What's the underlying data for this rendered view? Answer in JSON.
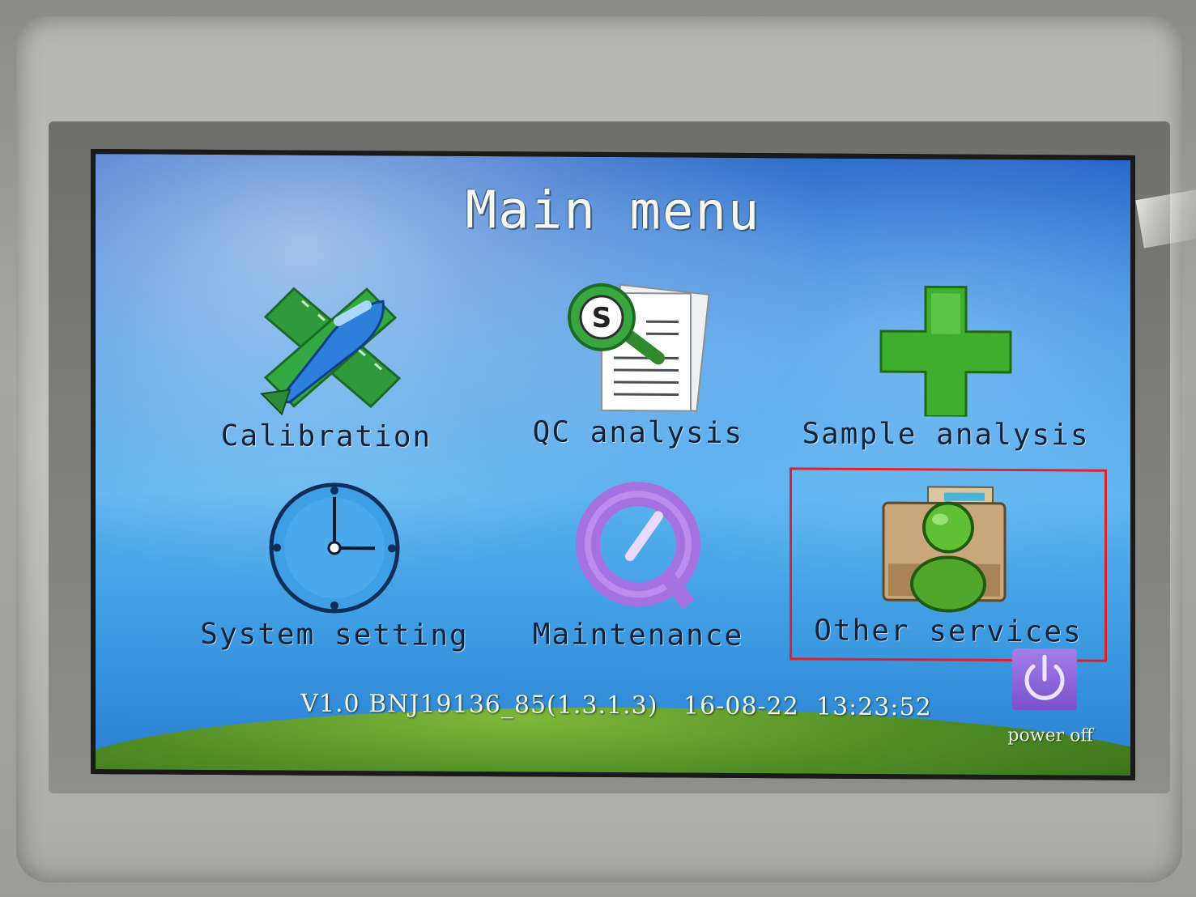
{
  "title": "Main menu",
  "menu": [
    {
      "label": "Calibration",
      "icon": "calibration-icon"
    },
    {
      "label": "QC analysis",
      "icon": "qc-analysis-icon"
    },
    {
      "label": "Sample analysis",
      "icon": "sample-analysis-icon"
    },
    {
      "label": "System setting",
      "icon": "clock-icon"
    },
    {
      "label": "Maintenance",
      "icon": "maintenance-icon"
    },
    {
      "label": "Other services",
      "icon": "other-services-icon",
      "selected": true
    }
  ],
  "status": {
    "version": "V1.0 BNJ19136_85(1.3.1.3)",
    "date": "16-08-22",
    "time": "13:23:52"
  },
  "power": {
    "label": "power off",
    "icon": "power-icon"
  },
  "colors": {
    "screen_blue": "#3b8fe2",
    "selection_border": "#e0202a",
    "power_button": "#8b63d8",
    "grass": "#4e8b24"
  }
}
